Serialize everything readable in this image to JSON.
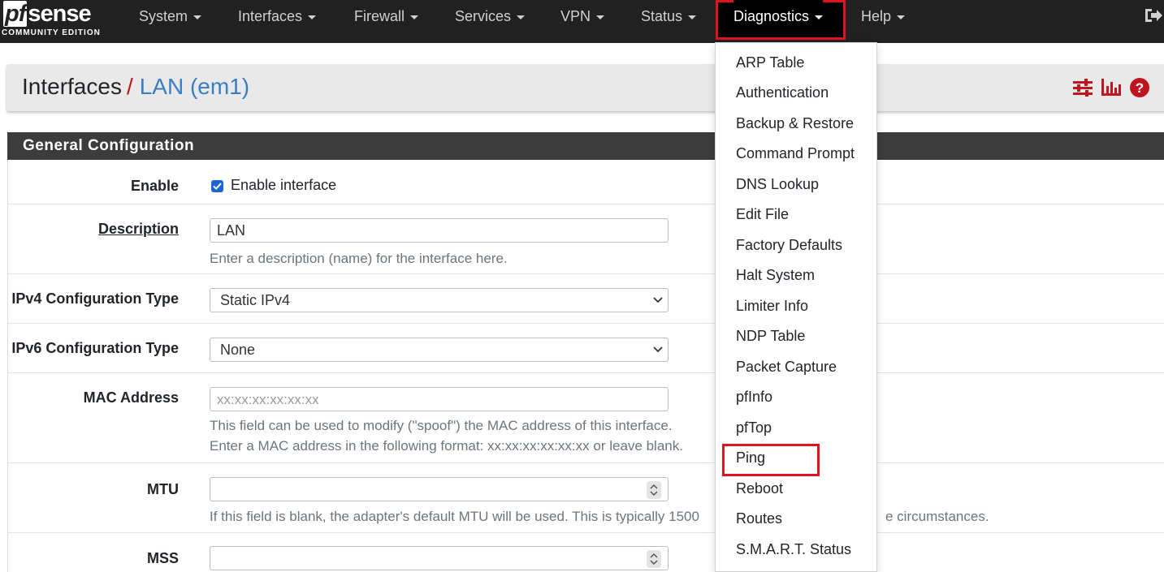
{
  "brand": {
    "logo_pf": "pf",
    "logo_sense": "sense",
    "edition": "COMMUNITY EDITION"
  },
  "nav": {
    "items": [
      {
        "label": "System"
      },
      {
        "label": "Interfaces"
      },
      {
        "label": "Firewall"
      },
      {
        "label": "Services"
      },
      {
        "label": "VPN"
      },
      {
        "label": "Status"
      },
      {
        "label": "Diagnostics"
      },
      {
        "label": "Help"
      }
    ],
    "active": "Diagnostics",
    "logout_icon": "sign-out-icon"
  },
  "breadcrumb": {
    "parent": "Interfaces",
    "separator": "/",
    "current": "LAN (em1)",
    "icons": [
      "sliders-icon",
      "bar-chart-icon",
      "question-circle-icon"
    ]
  },
  "panel": {
    "title": "General Configuration",
    "enable": {
      "label": "Enable",
      "checkbox_label": "Enable interface",
      "checked": true
    },
    "description": {
      "label": "Description",
      "value": "LAN",
      "help": "Enter a description (name) for the interface here."
    },
    "ipv4_type": {
      "label": "IPv4 Configuration Type",
      "value": "Static IPv4"
    },
    "ipv6_type": {
      "label": "IPv6 Configuration Type",
      "value": "None"
    },
    "mac": {
      "label": "MAC Address",
      "placeholder": "xx:xx:xx:xx:xx:xx",
      "help1": "This field can be used to modify (\"spoof\") the MAC address of this interface.",
      "help2": "Enter a MAC address in the following format: xx:xx:xx:xx:xx:xx or leave blank."
    },
    "mtu": {
      "label": "MTU",
      "help_left": "If this field is blank, the adapter's default MTU will be used. This is typically 1500",
      "help_right": "e circumstances."
    },
    "mss": {
      "label": "MSS"
    }
  },
  "diagnostics_menu": {
    "items": [
      "ARP Table",
      "Authentication",
      "Backup & Restore",
      "Command Prompt",
      "DNS Lookup",
      "Edit File",
      "Factory Defaults",
      "Halt System",
      "Limiter Info",
      "NDP Table",
      "Packet Capture",
      "pfInfo",
      "pfTop",
      "Ping",
      "Reboot",
      "Routes",
      "S.M.A.R.T. Status"
    ],
    "highlighted": "Ping"
  },
  "colors": {
    "navbar": "#212121",
    "highlight_border": "#e0141e",
    "breadcrumb_link": "#3a7ec2",
    "panel_header": "#3c3c3c",
    "icon_red": "#c0141e"
  }
}
